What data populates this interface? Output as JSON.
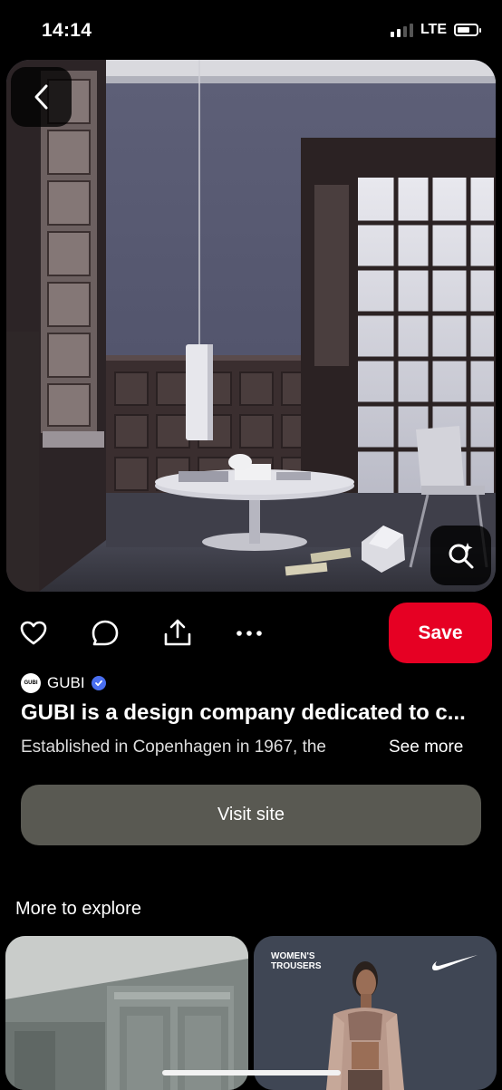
{
  "status": {
    "time": "14:14",
    "network": "LTE"
  },
  "pin": {
    "author": "GUBI",
    "author_avatar_text": "GUBI",
    "title": "GUBI is a design company dedicated to c...",
    "description": "Established in Copenhagen in 1967, the",
    "see_more": "See more"
  },
  "actions": {
    "save_label": "Save",
    "visit_label": "Visit site"
  },
  "explore": {
    "title": "More to explore",
    "cards": [
      {
        "label": ""
      },
      {
        "label": "WOMEN'S\nTROUSERS"
      }
    ]
  },
  "icons": [
    "back-arrow-icon",
    "visual-search-icon",
    "heart-icon",
    "comment-icon",
    "share-icon",
    "more-icon",
    "verified-icon",
    "nike-logo-icon"
  ],
  "colors": {
    "save": "#e60023",
    "visit": "#595952",
    "verified": "#4a6ff0"
  }
}
